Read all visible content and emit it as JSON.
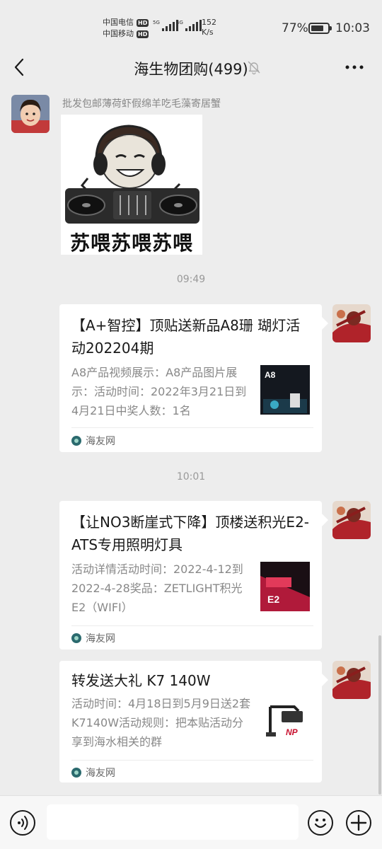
{
  "status_bar": {
    "carrier1": "中国电信",
    "carrier2": "中国移动",
    "hd": "HD",
    "net1": "5G",
    "net2": "4G",
    "speed_value": "152",
    "speed_unit": "K/s",
    "battery_percent": "77%",
    "battery_level": 0.77,
    "time": "10:03"
  },
  "nav": {
    "title": "海生物团购(499)",
    "back_icon": "chevron-left-icon",
    "mute_icon": "bell-off-icon",
    "more_icon": "more-horizontal-icon"
  },
  "messages": {
    "sticker_msg": {
      "sender": "批发包邮薄荷虾假绵羊吃毛藻寄居蟹",
      "caption": "苏喂苏喂苏喂"
    },
    "time1": "09:49",
    "time2": "10:01",
    "cards": [
      {
        "title": "【A+智控】顶贴送新品A8珊 瑚灯活动202204期",
        "desc": "A8产品视频展示：A8产品图片展示：活动时间：2022年3月21日到4月21日中奖人数：1名",
        "thumb_text": "A8",
        "source": "海友网"
      },
      {
        "title": "【让NO3断崖式下降】顶楼送积光E2-ATS专用照明灯具",
        "desc": "活动详情活动时间：2022-4-12到2022-4-28奖品：ZETLIGHT积光E2（WIFI）",
        "thumb_text": "E2",
        "source": "海友网"
      },
      {
        "title": "转发送大礼 K7 140W",
        "desc": "活动时间：4月18日到5月9日送2套K7140W活动规则：把本贴活动分享到海水相关的群",
        "thumb_text": "NP",
        "source": "海友网"
      }
    ]
  },
  "input_bar": {
    "voice_icon": "voice-icon",
    "emoji_icon": "emoji-icon",
    "plus_icon": "plus-icon",
    "placeholder": ""
  },
  "colors": {
    "background": "#ededed",
    "card": "#ffffff",
    "muted_text": "#888888"
  }
}
